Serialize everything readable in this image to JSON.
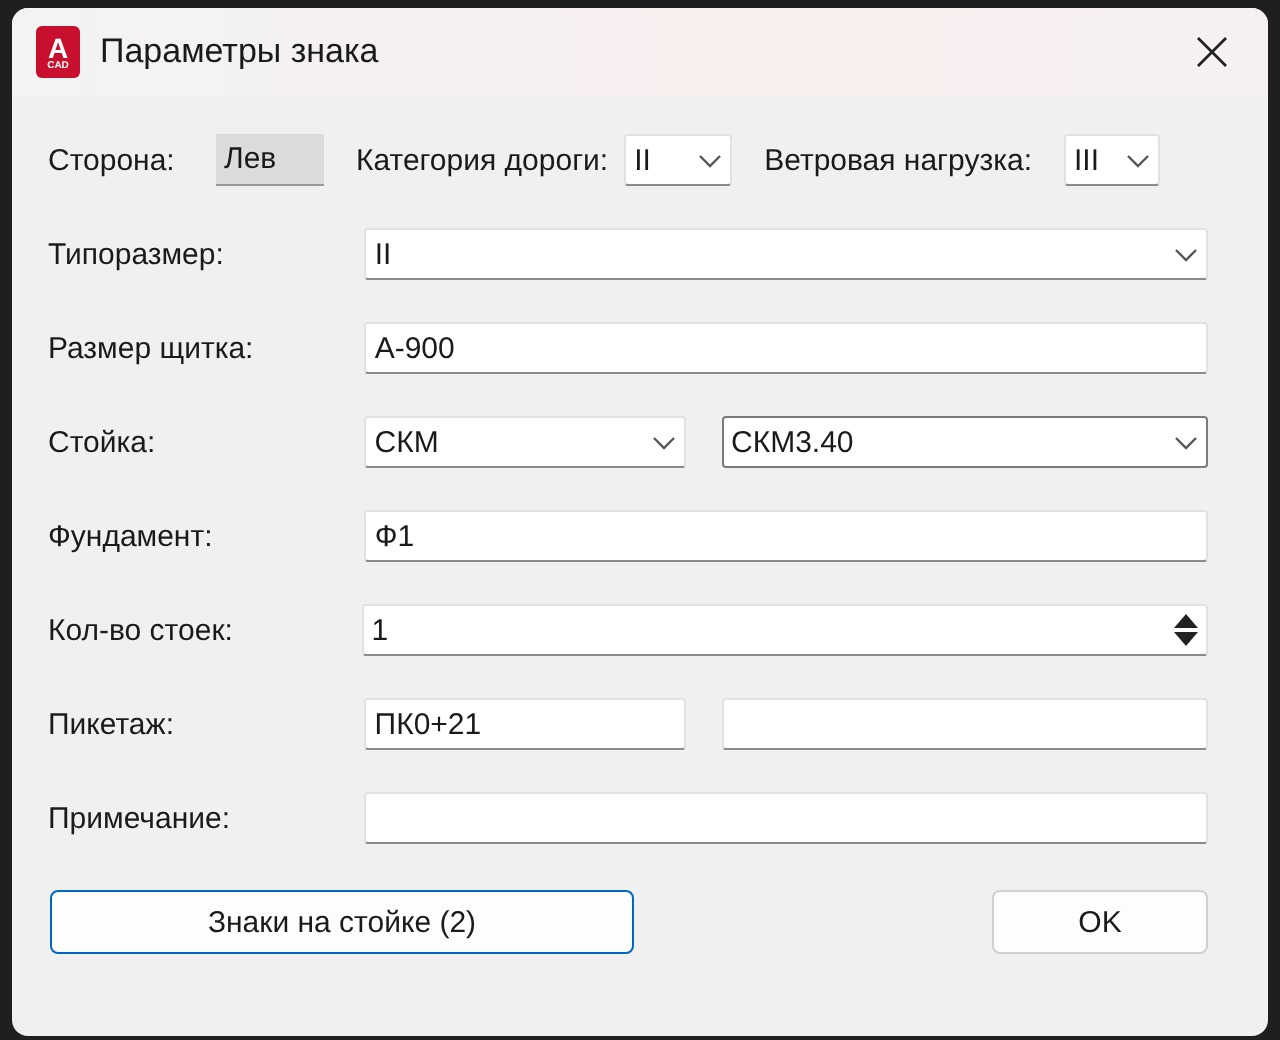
{
  "window": {
    "title": "Параметры знака",
    "icon": {
      "letter": "A",
      "caption": "CAD"
    }
  },
  "top_row": [
    {
      "kind": "readonly",
      "label": "Сторона:",
      "value": "Лев"
    },
    {
      "kind": "combo",
      "label": "Категория дороги:",
      "value": "II"
    },
    {
      "kind": "combo",
      "label": "Ветровая нагрузка:",
      "value": "III"
    }
  ],
  "rows": [
    {
      "label": "Типоразмер:",
      "fields": [
        {
          "kind": "combo",
          "value": "II",
          "focused": false
        }
      ]
    },
    {
      "label": "Размер щитка:",
      "fields": [
        {
          "kind": "text",
          "value": "А-900",
          "focused": false
        }
      ]
    },
    {
      "label": "Стойка:",
      "fields": [
        {
          "kind": "combo",
          "value": "СКМ",
          "focused": false
        },
        {
          "kind": "combo",
          "value": "СКМ3.40",
          "focused": true
        }
      ]
    },
    {
      "label": "Фундамент:",
      "fields": [
        {
          "kind": "text",
          "value": "Ф1",
          "focused": false
        }
      ]
    },
    {
      "label": "Кол-во стоек:",
      "fields": [
        {
          "kind": "spin",
          "value": "1",
          "focused": false
        }
      ]
    },
    {
      "label": "Пикетаж:",
      "fields": [
        {
          "kind": "text",
          "value": "ПК0+21",
          "focused": false
        },
        {
          "kind": "text",
          "focused": false
        }
      ]
    },
    {
      "label": "Примечание:",
      "fields": [
        {
          "kind": "text",
          "focused": false
        }
      ]
    }
  ],
  "buttons": [
    {
      "label": "Знаки на стойке (2)",
      "default": true
    },
    {
      "label": "OK",
      "default": false
    }
  ]
}
